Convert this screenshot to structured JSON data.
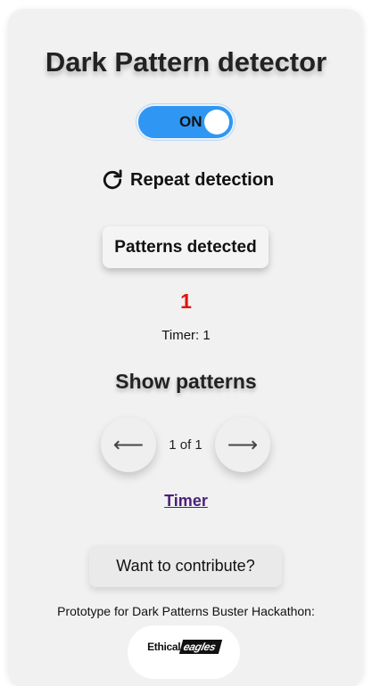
{
  "header": {
    "title": "Dark Pattern detector"
  },
  "toggle": {
    "label": "ON",
    "state": "on",
    "color": "#2f96f3"
  },
  "repeat": {
    "icon": "refresh-icon",
    "label": "Repeat detection"
  },
  "patterns": {
    "button_label": "Patterns detected",
    "count": "1",
    "count_color": "#e0140d",
    "timer_text": "Timer: 1"
  },
  "show_patterns": {
    "title": "Show patterns",
    "prev_icon": "arrow-left-icon",
    "prev_glyph": "⟵",
    "next_icon": "arrow-right-icon",
    "next_glyph": "⟶",
    "page_indicator": "1 of 1",
    "link_label": "Timer"
  },
  "footer": {
    "contribute_label": "Want to contribute?",
    "prototype_text": "Prototype for Dark Patterns Buster Hackathon:",
    "logo_part1": "Ethical",
    "logo_part2": "eagles"
  }
}
